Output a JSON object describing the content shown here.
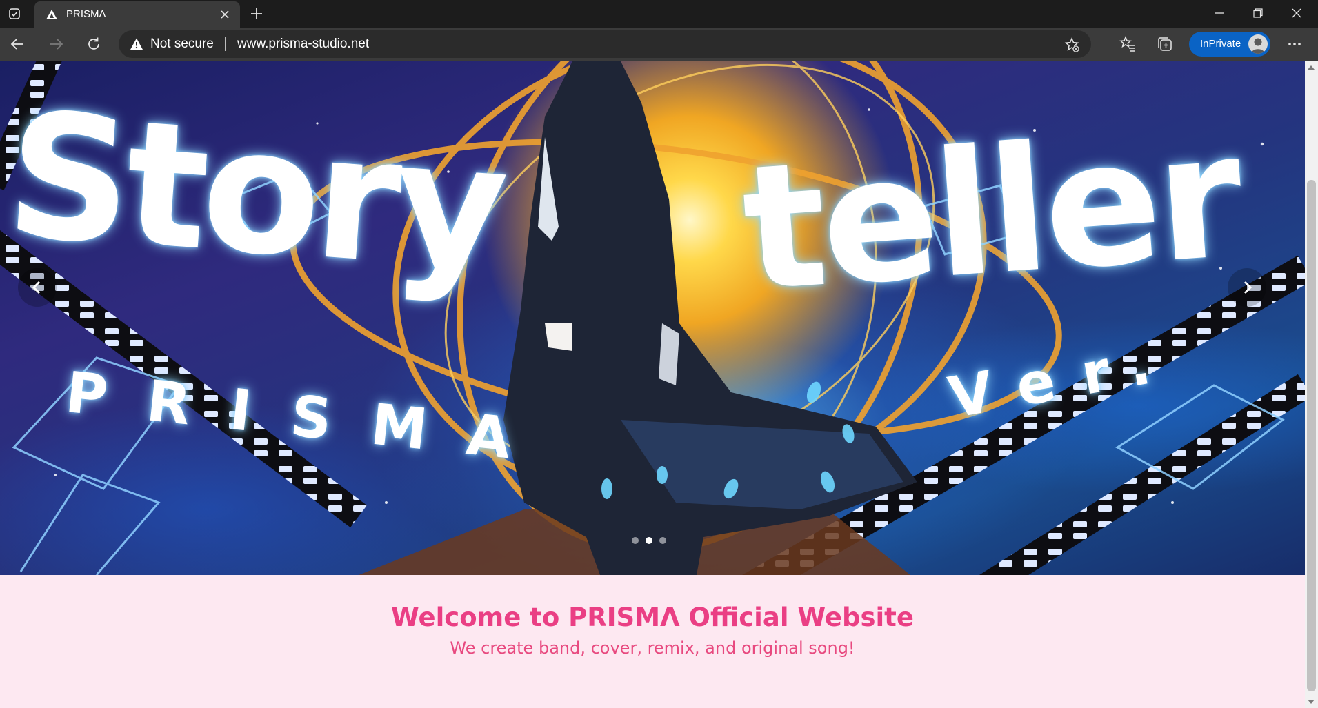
{
  "browser": {
    "tab": {
      "title": "PRISMΛ",
      "favicon": "prisma-triangle-icon"
    },
    "address": {
      "security_label": "Not secure",
      "url": "www.prisma-studio.net"
    },
    "inprivate_label": "InPrivate",
    "icons": {
      "tab_actions": "tab-actions-icon",
      "new_tab": "plus-icon",
      "back": "back-arrow-icon",
      "forward": "forward-arrow-icon",
      "refresh": "refresh-icon",
      "add_favorite": "star-add-icon",
      "favorites": "favorites-icon",
      "collections": "collections-icon",
      "more": "more-icon",
      "minimize": "minimize-icon",
      "restore": "restore-icon",
      "close": "close-icon"
    }
  },
  "hero": {
    "headline_word_1": "Story",
    "headline_word_2": "teller",
    "subtitle_1": "PRISMA",
    "subtitle_2": "Ver.",
    "slide_count": 3,
    "active_slide": 2
  },
  "welcome": {
    "title": "Welcome to PRISMΛ Official Website",
    "subtitle": "We create band, cover, remix, and original song!"
  },
  "colors": {
    "accent_pink": "#ea3f84",
    "page_bg": "#fde8f1",
    "inprivate_blue": "#0a63c5"
  }
}
